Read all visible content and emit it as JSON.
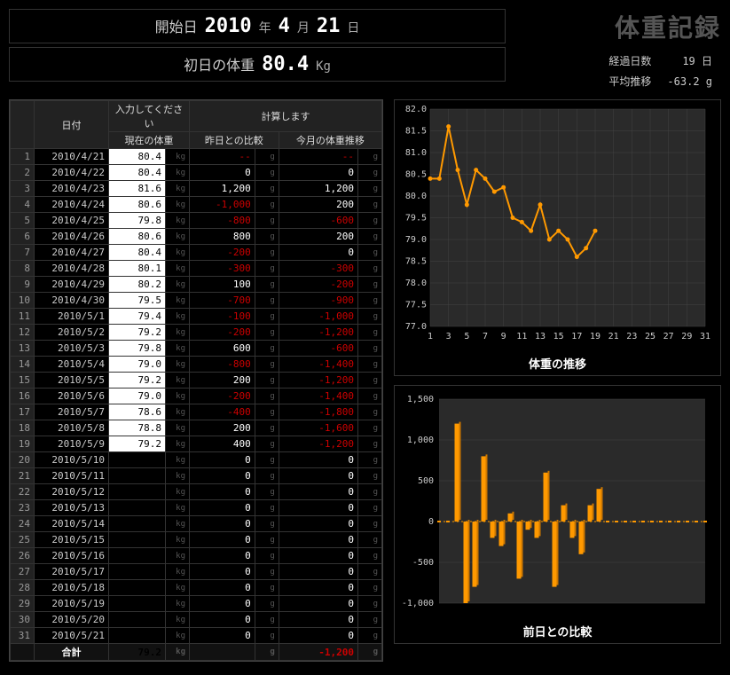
{
  "header": {
    "startDateLabel": "開始日",
    "year": "2010",
    "yearUnit": "年",
    "month": "4",
    "monthUnit": "月",
    "day": "21",
    "dayUnit": "日",
    "initialWeightLabel": "初日の体重",
    "initialWeight": "80.4",
    "weightUnit": "Kg",
    "appTitle": "体重記録",
    "elapsedLabel": "経過日数",
    "elapsedValue": "19 日",
    "avgLabel": "平均推移",
    "avgValue": "-63.2 g"
  },
  "table": {
    "col_date": "日付",
    "col_input_group": "入力してください",
    "col_weight": "現在の体重",
    "col_calc_group": "計算します",
    "col_diff": "昨日との比較",
    "col_trend": "今月の体重推移",
    "unit_kg": "kg",
    "unit_g": "g",
    "totalLabel": "合計",
    "totalWeight": "79.2",
    "totalTrend": "-1,200",
    "rows": [
      {
        "n": 1,
        "date": "2010/4/21",
        "w": "80.4",
        "diff": "--",
        "trend": "--"
      },
      {
        "n": 2,
        "date": "2010/4/22",
        "w": "80.4",
        "diff": "0",
        "trend": "0"
      },
      {
        "n": 3,
        "date": "2010/4/23",
        "w": "81.6",
        "diff": "1,200",
        "trend": "1,200"
      },
      {
        "n": 4,
        "date": "2010/4/24",
        "w": "80.6",
        "diff": "-1,000",
        "trend": "200"
      },
      {
        "n": 5,
        "date": "2010/4/25",
        "w": "79.8",
        "diff": "-800",
        "trend": "-600"
      },
      {
        "n": 6,
        "date": "2010/4/26",
        "w": "80.6",
        "diff": "800",
        "trend": "200"
      },
      {
        "n": 7,
        "date": "2010/4/27",
        "w": "80.4",
        "diff": "-200",
        "trend": "0"
      },
      {
        "n": 8,
        "date": "2010/4/28",
        "w": "80.1",
        "diff": "-300",
        "trend": "-300"
      },
      {
        "n": 9,
        "date": "2010/4/29",
        "w": "80.2",
        "diff": "100",
        "trend": "-200"
      },
      {
        "n": 10,
        "date": "2010/4/30",
        "w": "79.5",
        "diff": "-700",
        "trend": "-900"
      },
      {
        "n": 11,
        "date": "2010/5/1",
        "w": "79.4",
        "diff": "-100",
        "trend": "-1,000"
      },
      {
        "n": 12,
        "date": "2010/5/2",
        "w": "79.2",
        "diff": "-200",
        "trend": "-1,200"
      },
      {
        "n": 13,
        "date": "2010/5/3",
        "w": "79.8",
        "diff": "600",
        "trend": "-600"
      },
      {
        "n": 14,
        "date": "2010/5/4",
        "w": "79.0",
        "diff": "-800",
        "trend": "-1,400"
      },
      {
        "n": 15,
        "date": "2010/5/5",
        "w": "79.2",
        "diff": "200",
        "trend": "-1,200"
      },
      {
        "n": 16,
        "date": "2010/5/6",
        "w": "79.0",
        "diff": "-200",
        "trend": "-1,400"
      },
      {
        "n": 17,
        "date": "2010/5/7",
        "w": "78.6",
        "diff": "-400",
        "trend": "-1,800"
      },
      {
        "n": 18,
        "date": "2010/5/8",
        "w": "78.8",
        "diff": "200",
        "trend": "-1,600"
      },
      {
        "n": 19,
        "date": "2010/5/9",
        "w": "79.2",
        "diff": "400",
        "trend": "-1,200"
      },
      {
        "n": 20,
        "date": "2010/5/10",
        "w": "",
        "diff": "0",
        "trend": "0"
      },
      {
        "n": 21,
        "date": "2010/5/11",
        "w": "",
        "diff": "0",
        "trend": "0"
      },
      {
        "n": 22,
        "date": "2010/5/12",
        "w": "",
        "diff": "0",
        "trend": "0"
      },
      {
        "n": 23,
        "date": "2010/5/13",
        "w": "",
        "diff": "0",
        "trend": "0"
      },
      {
        "n": 24,
        "date": "2010/5/14",
        "w": "",
        "diff": "0",
        "trend": "0"
      },
      {
        "n": 25,
        "date": "2010/5/15",
        "w": "",
        "diff": "0",
        "trend": "0"
      },
      {
        "n": 26,
        "date": "2010/5/16",
        "w": "",
        "diff": "0",
        "trend": "0"
      },
      {
        "n": 27,
        "date": "2010/5/17",
        "w": "",
        "diff": "0",
        "trend": "0"
      },
      {
        "n": 28,
        "date": "2010/5/18",
        "w": "",
        "diff": "0",
        "trend": "0"
      },
      {
        "n": 29,
        "date": "2010/5/19",
        "w": "",
        "diff": "0",
        "trend": "0"
      },
      {
        "n": 30,
        "date": "2010/5/20",
        "w": "",
        "diff": "0",
        "trend": "0"
      },
      {
        "n": 31,
        "date": "2010/5/21",
        "w": "",
        "diff": "0",
        "trend": "0"
      }
    ]
  },
  "chart_data": [
    {
      "type": "line",
      "title": "体重の推移",
      "x": [
        1,
        2,
        3,
        4,
        5,
        6,
        7,
        8,
        9,
        10,
        11,
        12,
        13,
        14,
        15,
        16,
        17,
        18,
        19
      ],
      "values": [
        80.4,
        80.4,
        81.6,
        80.6,
        79.8,
        80.6,
        80.4,
        80.1,
        80.2,
        79.5,
        79.4,
        79.2,
        79.8,
        79.0,
        79.2,
        79.0,
        78.6,
        78.8,
        79.2
      ],
      "xticks": [
        1,
        3,
        5,
        7,
        9,
        11,
        13,
        15,
        17,
        19,
        21,
        23,
        25,
        27,
        29,
        31
      ],
      "yticks": [
        77.0,
        77.5,
        78.0,
        78.5,
        79.0,
        79.5,
        80.0,
        80.5,
        81.0,
        81.5,
        82.0
      ],
      "xlim": [
        1,
        31
      ],
      "ylim": [
        77.0,
        82.0
      ]
    },
    {
      "type": "bar",
      "title": "前日との比較",
      "x": [
        1,
        2,
        3,
        4,
        5,
        6,
        7,
        8,
        9,
        10,
        11,
        12,
        13,
        14,
        15,
        16,
        17,
        18,
        19,
        20,
        21,
        22,
        23,
        24,
        25,
        26,
        27,
        28,
        29,
        30,
        31
      ],
      "values": [
        0,
        0,
        1200,
        -1000,
        -800,
        800,
        -200,
        -300,
        100,
        -700,
        -100,
        -200,
        600,
        -800,
        200,
        -200,
        -400,
        200,
        400,
        0,
        0,
        0,
        0,
        0,
        0,
        0,
        0,
        0,
        0,
        0,
        0
      ],
      "yticks": [
        -1000,
        -500,
        0,
        500,
        1000,
        1500
      ],
      "xlim": [
        1,
        31
      ],
      "ylim": [
        -1000,
        1500
      ]
    }
  ]
}
